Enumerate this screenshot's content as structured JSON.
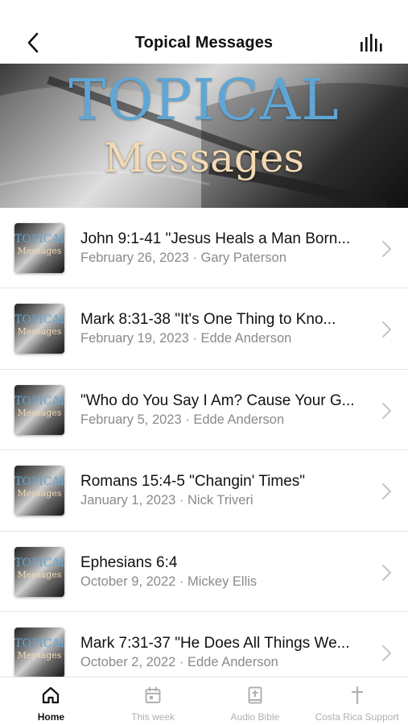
{
  "header": {
    "title": "Topical Messages",
    "back_icon": "chevron-left-icon",
    "audio_icon": "audio-bars-icon"
  },
  "hero": {
    "line1": "TOPICAL",
    "line2": "Messages"
  },
  "thumbnail": {
    "line1": "TOPICAL",
    "line2": "Messages"
  },
  "messages": [
    {
      "title": "John 9:1-41 \"Jesus Heals a Man Born...",
      "subtitle": "February 26, 2023 · Gary Paterson"
    },
    {
      "title": "Mark 8:31-38 \"It's One Thing to Kno...",
      "subtitle": "February 19, 2023 · Edde Anderson"
    },
    {
      "title": "\"Who do You Say I Am? Cause Your G...",
      "subtitle": "February 5, 2023 · Edde Anderson"
    },
    {
      "title": "Romans 15:4-5 \"Changin' Times\"",
      "subtitle": "January 1, 2023 · Nick Triveri"
    },
    {
      "title": "Ephesians 6:4",
      "subtitle": "October 9, 2022 · Mickey Ellis"
    },
    {
      "title": "Mark 7:31-37 \"He Does All Things We...",
      "subtitle": "October 2, 2022 · Edde Anderson"
    }
  ],
  "tabs": [
    {
      "label": "Home",
      "icon": "home-icon",
      "active": true
    },
    {
      "label": "This week",
      "icon": "calendar-icon",
      "active": false
    },
    {
      "label": "Audio Bible",
      "icon": "bible-icon",
      "active": false
    },
    {
      "label": "Costa Rica Support",
      "icon": "cross-icon",
      "active": false
    }
  ],
  "colors": {
    "accent_blue": "#5fa6d6",
    "accent_cream": "#f3d9b3",
    "text_primary": "#111111",
    "text_secondary": "#8a8a8a",
    "tab_inactive": "#b0b0b0"
  }
}
